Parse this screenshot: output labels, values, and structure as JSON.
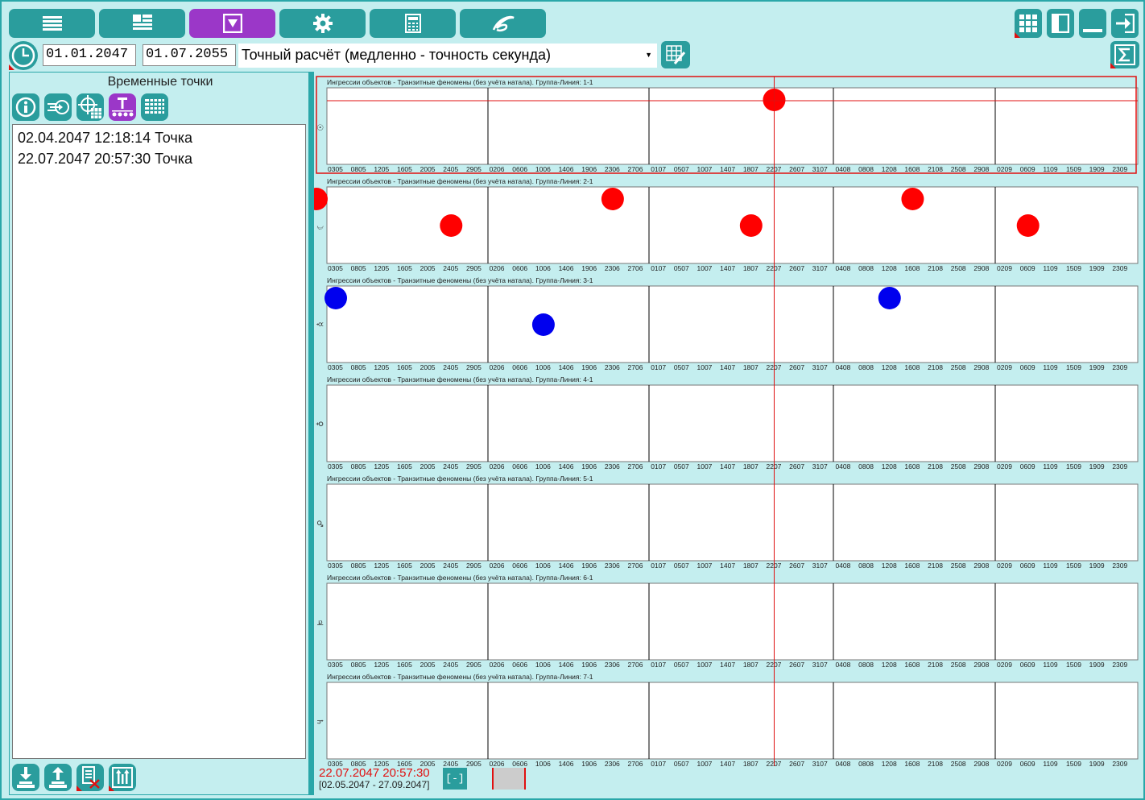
{
  "nav": [
    {
      "name": "menu",
      "icon": "list-icon"
    },
    {
      "name": "layout",
      "icon": "dashboard-icon"
    },
    {
      "name": "filter",
      "icon": "filter-icon",
      "active": true
    },
    {
      "name": "settings",
      "icon": "gear-icon"
    },
    {
      "name": "calculator",
      "icon": "calculator-icon"
    },
    {
      "name": "logo",
      "icon": "logo-icon"
    }
  ],
  "window_controls": [
    "grid-icon",
    "panel-icon",
    "minimize-icon",
    "exit-icon"
  ],
  "dates": {
    "start": "01.01.2047",
    "end": "01.07.2055"
  },
  "mode": {
    "value": "Точный расчёт (медленно - точность секунда)"
  },
  "left_panel": {
    "title": "Временные точки",
    "items": [
      "02.04.2047 12:18:14 Точка",
      "22.07.2047 20:57:30 Точка"
    ]
  },
  "footer": {
    "current": "22.07.2047 20:57:30",
    "range": "[02.05.2047 - 27.09.2047]",
    "collapse": "[-]"
  },
  "colors": {
    "accent": "#2aa7a9",
    "active": "#9b37c8",
    "red": "#ff0000",
    "blue": "#0000ee",
    "bg": "#c4eeef"
  },
  "chart_data": {
    "type": "scatter",
    "title_prefix": "Ингрессии объектов - Транзитные феномены (без учёта натала). Группа-Линия:",
    "ticks": [
      "0305",
      "0805",
      "1205",
      "1605",
      "2005",
      "2405",
      "2905",
      "0206",
      "0606",
      "1006",
      "1406",
      "1906",
      "2306",
      "2706",
      "0107",
      "0507",
      "1007",
      "1407",
      "1807",
      "2207",
      "2607",
      "3107",
      "0408",
      "0808",
      "1208",
      "1608",
      "2108",
      "2508",
      "2908",
      "0209",
      "0609",
      "1109",
      "1509",
      "1909",
      "2309"
    ],
    "cursor_date": "2207",
    "rows": [
      {
        "label": "1-1",
        "symbol": "☉",
        "points": [
          {
            "x": "2207",
            "level": "top",
            "color": "red"
          }
        ]
      },
      {
        "label": "2-1",
        "symbol": "☽",
        "points": [
          {
            "x": "0305",
            "level": "top",
            "color": "red",
            "edge": true
          },
          {
            "x": "2405",
            "level": "mid",
            "color": "red"
          },
          {
            "x": "2306",
            "level": "top",
            "color": "red"
          },
          {
            "x": "1807",
            "level": "mid",
            "color": "red"
          },
          {
            "x": "1608",
            "level": "top",
            "color": "red"
          },
          {
            "x": "0609",
            "level": "mid",
            "color": "red"
          }
        ]
      },
      {
        "label": "3-1",
        "symbol": "☿",
        "points": [
          {
            "x": "0305",
            "level": "top",
            "color": "blue"
          },
          {
            "x": "1006",
            "level": "mid",
            "color": "blue"
          },
          {
            "x": "1208",
            "level": "top",
            "color": "blue"
          }
        ]
      },
      {
        "label": "4-1",
        "symbol": "♀",
        "points": []
      },
      {
        "label": "5-1",
        "symbol": "♂",
        "points": []
      },
      {
        "label": "6-1",
        "symbol": "♃",
        "points": []
      },
      {
        "label": "7-1",
        "symbol": "♄",
        "points": []
      }
    ]
  }
}
